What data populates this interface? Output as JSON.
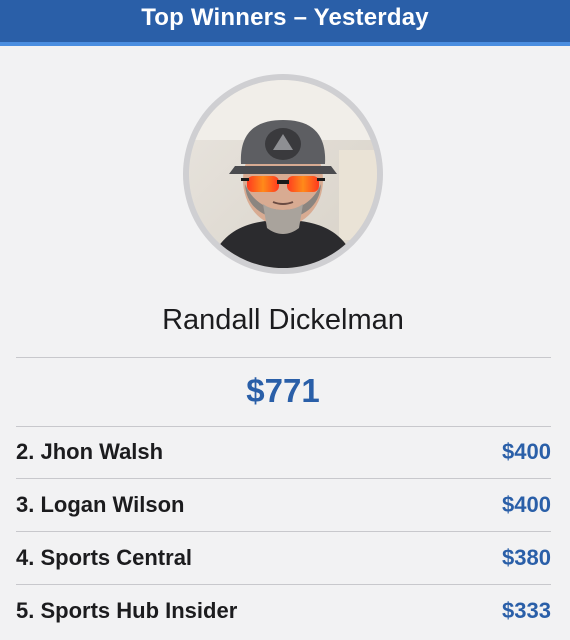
{
  "header": {
    "title": "Top Winners – Yesterday"
  },
  "winner": {
    "name": "Randall Dickelman",
    "amount": "$771"
  },
  "rankings": [
    {
      "label": "2. Jhon Walsh",
      "amount": "$400"
    },
    {
      "label": "3. Logan Wilson",
      "amount": "$400"
    },
    {
      "label": "4. Sports Central",
      "amount": "$380"
    },
    {
      "label": "5. Sports Hub Insider",
      "amount": "$333"
    }
  ],
  "colors": {
    "header_bg": "#2a5fa8",
    "accent": "#2a5fa8",
    "header_underline": "#4b8ee0"
  }
}
